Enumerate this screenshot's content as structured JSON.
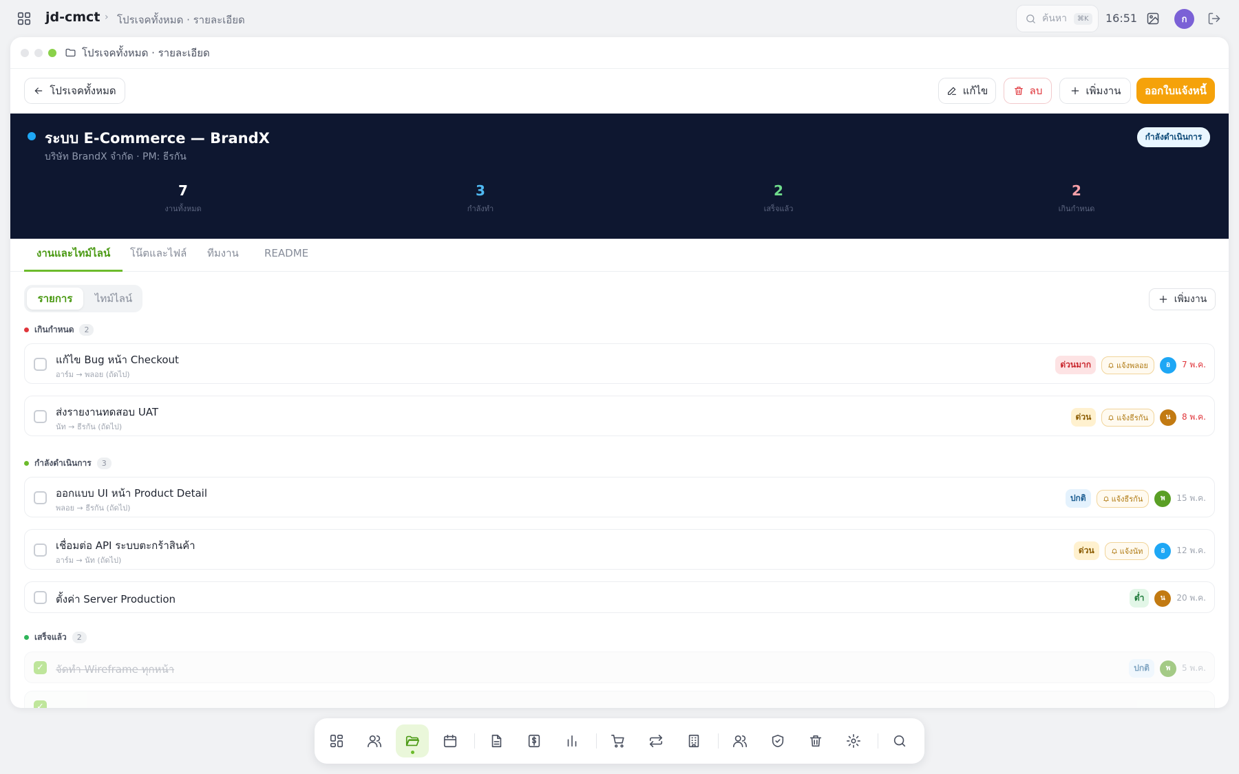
{
  "topbar": {
    "app_name": "jd-cmct",
    "breadcrumb": "โปรเจคทั้งหมด · รายละเอียด",
    "search_placeholder": "ค้นหา",
    "search_shortcut": "⌘K",
    "clock": "16:51",
    "user_initial": "ก"
  },
  "window": {
    "title": "โปรเจคทั้งหมด · รายละเอียด",
    "back_label": "โปรเจคทั้งหมด",
    "edit_label": "แก้ไข",
    "delete_label": "ลบ",
    "add_task_label": "เพิ่มงาน",
    "invoice_label": "ออกใบแจ้งหนี้"
  },
  "project": {
    "name": "ระบบ E-Commerce — BrandX",
    "subtitle": "บริษัท BrandX จำกัด · PM: ธีรกัน",
    "status": "กำลังดำเนินการ",
    "stats": [
      {
        "value": "7",
        "label": "งานทั้งหมด",
        "color": "#ffffff"
      },
      {
        "value": "3",
        "label": "กำลังทำ",
        "color": "#4fb9f2"
      },
      {
        "value": "2",
        "label": "เสร็จแล้ว",
        "color": "#6fdc8c"
      },
      {
        "value": "2",
        "label": "เกินกำหนด",
        "color": "#f6a0a8"
      }
    ]
  },
  "tabs": [
    "งานและไทม์ไลน์",
    "โน๊ตและไฟล์",
    "ทีมงาน",
    "README"
  ],
  "view": {
    "list": "รายการ",
    "timeline": "ไทม์ไลน์",
    "add_task": "เพิ่มงาน"
  },
  "groups": [
    {
      "label": "เกินกำหนด",
      "count": "2",
      "color": "#e0353b"
    },
    {
      "label": "กำลังดำเนินการ",
      "count": "3",
      "color": "#6cbb2b"
    },
    {
      "label": "เสร็จแล้ว",
      "count": "2",
      "color": "#2fb55a"
    }
  ],
  "tasks": [
    {
      "title": "แก้ไข Bug หน้า Checkout",
      "sub": "อาร์ม → พลอย (ถัดไป)",
      "priority": "ด่วนมาก",
      "notify": "แจ้งพลอย",
      "avatar": "อ",
      "avatar_color": "#1ea7f5",
      "due": "7 พ.ค."
    },
    {
      "title": "ส่งรายงานทดสอบ UAT",
      "sub": "นัท → ธีรกัน (ถัดไป)",
      "priority": "ด่วน",
      "notify": "แจ้งธีรกัน",
      "avatar": "น",
      "avatar_color": "#c27a12",
      "due": "8 พ.ค."
    },
    {
      "title": "ออกแบบ UI หน้า Product Detail",
      "sub": "พลอย → ธีรกัน (ถัดไป)",
      "priority": "ปกติ",
      "notify": "แจ้งธีรกัน",
      "avatar": "พ",
      "avatar_color": "#5a9f25",
      "due": "15 พ.ค."
    },
    {
      "title": "เชื่อมต่อ API ระบบตะกร้าสินค้า",
      "sub": "อาร์ม → นัท (ถัดไป)",
      "priority": "ด่วน",
      "notify": "แจ้งนัท",
      "avatar": "อ",
      "avatar_color": "#1ea7f5",
      "due": "12 พ.ค."
    },
    {
      "title": "ตั้งค่า Server Production",
      "priority": "ต่ำ",
      "avatar": "น",
      "avatar_color": "#c27a12",
      "due": "20 พ.ค."
    },
    {
      "title": "จัดทำ Wireframe ทุกหน้า",
      "priority": "ปกติ",
      "avatar": "พ",
      "avatar_color": "#5a9f25",
      "due": "5 พ.ค."
    }
  ],
  "priority_colors": {
    "ด่วนมาก": {
      "bg": "#fde3e4",
      "fg": "#c9252c"
    },
    "ด่วน": {
      "bg": "#fff1cf",
      "fg": "#8a5a00"
    },
    "ปกติ": {
      "bg": "#e4f2fd",
      "fg": "#1d5f93"
    },
    "ต่ำ": {
      "bg": "#e2f6e7",
      "fg": "#1e7a3a"
    }
  },
  "dock_icons": [
    "dashboard-icon",
    "users-icon",
    "folder-icon",
    "calendar-icon",
    "document-icon",
    "dollar-icon",
    "chart-icon",
    "cart-icon",
    "transfer-icon",
    "building-icon",
    "team-icon",
    "shield-icon",
    "trash-icon",
    "settings-icon",
    "search-icon"
  ]
}
